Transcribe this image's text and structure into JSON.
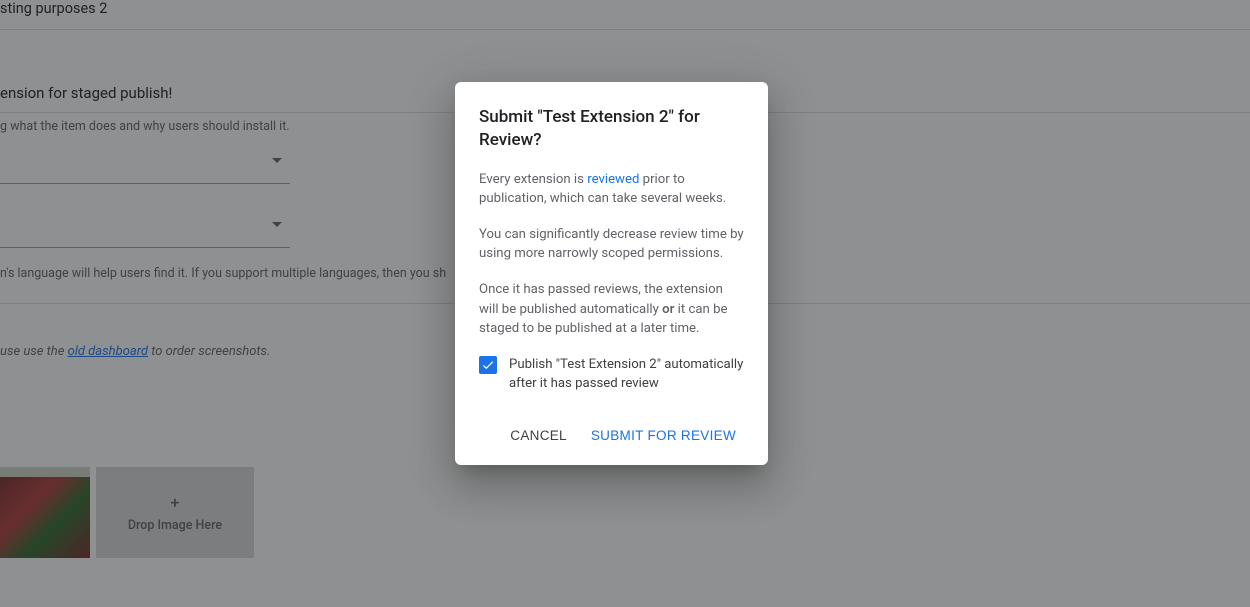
{
  "background": {
    "title_fragment": "sting purposes 2",
    "headline_fragment": "ension for staged publish!",
    "desc_hint_fragment": "g what the item does and why users should install it.",
    "lang_hint_fragment": "n's language will help users find it. If you support multiple languages, then you sh",
    "screenshots_hint_prefix": "use use the ",
    "screenshots_link": "old dashboard",
    "screenshots_hint_suffix": " to order screenshots.",
    "dropzone_label": "Drop Image Here"
  },
  "dialog": {
    "title": "Submit \"Test Extension 2\" for Review?",
    "p1_prefix": "Every extension is ",
    "p1_link": "reviewed",
    "p1_suffix": " prior to publication, which can take several weeks.",
    "p2": "You can significantly decrease review time by using more narrowly scoped permissions.",
    "p3_prefix": "Once it has passed reviews, the extension will be published automatically ",
    "p3_or": "or",
    "p3_suffix": " it can be staged to be published at a later time.",
    "checkbox_checked": true,
    "checkbox_label": "Publish \"Test Extension 2\" automatically after it has passed review",
    "cancel_label": "Cancel",
    "submit_label": "Submit for Review"
  }
}
